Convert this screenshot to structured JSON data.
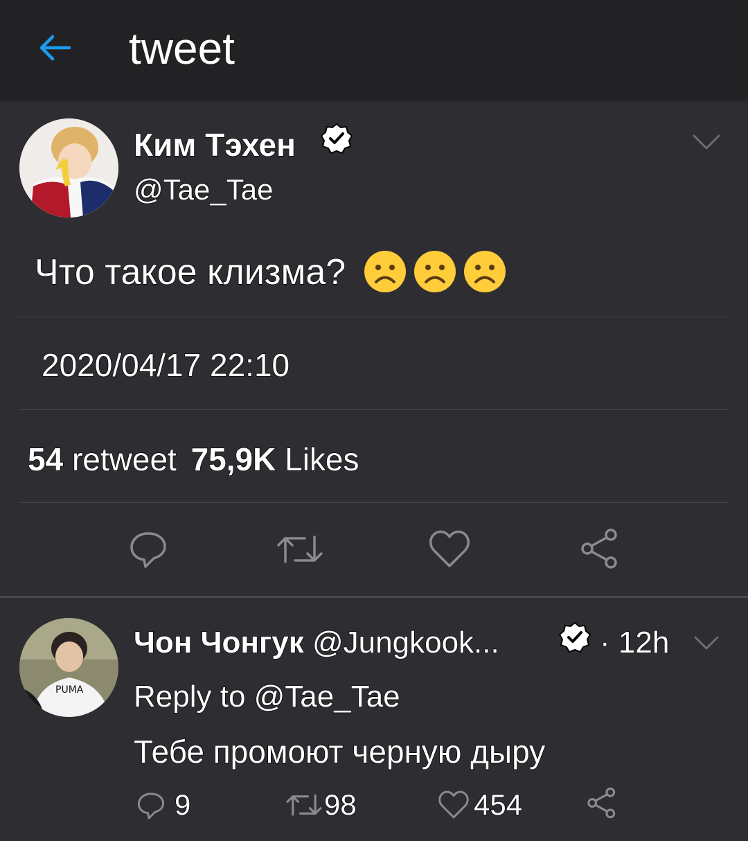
{
  "header": {
    "title": "tweet",
    "back_icon": "arrow-left-icon",
    "accent": "#1d9bf0"
  },
  "tweet": {
    "author_name": "Ким Тэхен",
    "handle": "@Tae_Tae",
    "text": "Что такое клизма?",
    "emojis": [
      "☹",
      "☹",
      "☹"
    ],
    "timestamp": "2020/04/17 22:10",
    "retweet_count": "54",
    "retweet_label": "retweet",
    "likes_count": "75,9K",
    "likes_label": "Likes",
    "actions": [
      "reply-icon",
      "retweet-icon",
      "like-icon",
      "share-icon"
    ]
  },
  "reply": {
    "author_name": "Чон Чонгук",
    "handle": "@Jungkook...",
    "separator": "·",
    "time": "12h",
    "reply_to": "Reply to @Tae_Tae",
    "text": "Тебе промоют черную дыру",
    "reply_count": "9",
    "retweet_count": "98",
    "like_count": "454"
  }
}
